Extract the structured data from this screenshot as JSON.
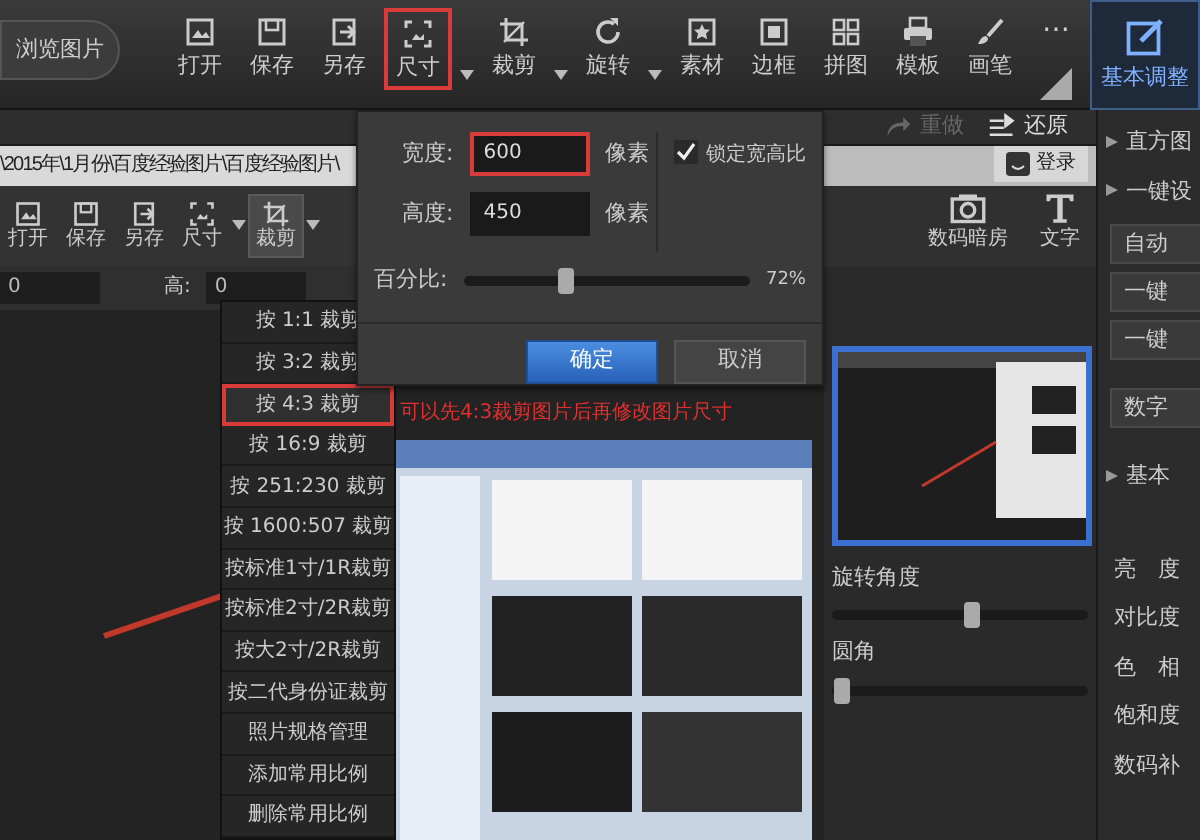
{
  "top_toolbar": {
    "browse_button": "浏览图片",
    "tools": [
      {
        "label": "打开",
        "selected": false,
        "caret": false
      },
      {
        "label": "保存",
        "selected": false,
        "caret": false
      },
      {
        "label": "另存",
        "selected": false,
        "caret": false
      },
      {
        "label": "尺寸",
        "selected": true,
        "caret": true
      },
      {
        "label": "裁剪",
        "selected": false,
        "caret": true
      },
      {
        "label": "旋转",
        "selected": false,
        "caret": true
      },
      {
        "label": "素材",
        "selected": false,
        "caret": false
      },
      {
        "label": "边框",
        "selected": false,
        "caret": false
      },
      {
        "label": "拼图",
        "selected": false,
        "caret": false
      },
      {
        "label": "模板",
        "selected": false,
        "caret": false
      },
      {
        "label": "画笔",
        "selected": false,
        "caret": false
      },
      {
        "label": "⋯",
        "selected": false,
        "caret": false
      }
    ],
    "side_tab": {
      "label": "基本调整",
      "selected": true
    }
  },
  "history_bar": {
    "redo": {
      "label": "重做",
      "disabled": true
    },
    "restore": {
      "label": "还原",
      "disabled": false
    }
  },
  "inner_window": {
    "path": "\\2015年\\1月份\\百度经验图片\\百度经验图片\\",
    "tools": [
      {
        "label": "打开",
        "selected": false,
        "caret": false
      },
      {
        "label": "保存",
        "selected": false,
        "caret": false
      },
      {
        "label": "另存",
        "selected": false,
        "caret": false
      },
      {
        "label": "尺寸",
        "selected": false,
        "caret": true
      },
      {
        "label": "裁剪",
        "selected": true,
        "caret": true
      }
    ],
    "width_value": "0",
    "height_label": "高:",
    "height_value": "0",
    "note": "可以先4:3裁剪图片后再修改图片尺寸",
    "login": "登录",
    "tabs": [
      {
        "label": "数码暗房"
      },
      {
        "label": "文字"
      }
    ],
    "rotate_label": "旋转角度",
    "rotate": {
      "level": 0.55
    },
    "corner_label": "圆角",
    "corner": {
      "level": 0.04
    }
  },
  "crop_menu": {
    "items": [
      {
        "label": "按 1:1 裁剪",
        "selected": false
      },
      {
        "label": "按 3:2 裁剪",
        "selected": false
      },
      {
        "label": "按 4:3 裁剪",
        "selected": true
      },
      {
        "label": "按 16:9 裁剪",
        "selected": false
      },
      {
        "label": "按 251:230 裁剪",
        "selected": false
      },
      {
        "label": "按 1600:507 裁剪",
        "selected": false
      },
      {
        "label": "按标准1寸/1R裁剪",
        "selected": false
      },
      {
        "label": "按标准2寸/2R裁剪",
        "selected": false
      },
      {
        "label": "按大2寸/2R裁剪",
        "selected": false
      },
      {
        "label": "按二代身份证裁剪",
        "selected": false
      },
      {
        "label": "照片规格管理",
        "selected": false
      },
      {
        "label": "添加常用比例",
        "selected": false
      },
      {
        "label": "删除常用比例",
        "selected": false
      }
    ]
  },
  "size_dialog": {
    "width_label": "宽度:",
    "width_value": "600",
    "width_selected": true,
    "width_unit": "像素",
    "height_label": "高度:",
    "height_value": "450",
    "height_unit": "像素",
    "lock_ratio": {
      "label": "锁定宽高比",
      "checked": true
    },
    "percent": {
      "label": "百分比:",
      "level": 0.36,
      "reading": "72%"
    },
    "ok": "确定",
    "cancel": "取消"
  },
  "right_panel": {
    "histogram": "直方图",
    "quick_setup": "一键设",
    "quick_buttons": [
      "自动",
      "一键",
      "一键"
    ],
    "digital_button": "数字",
    "basic": "基本",
    "labels": [
      "亮　度",
      "对比度",
      "色　相",
      "饱和度",
      "数码补"
    ]
  }
}
